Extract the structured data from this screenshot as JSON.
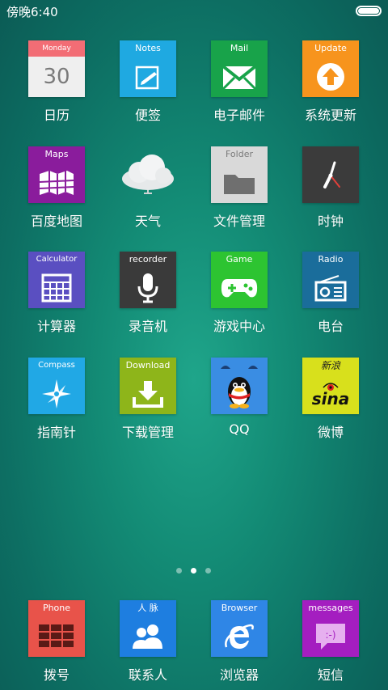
{
  "status": {
    "time": "傍晚6:40"
  },
  "apps": [
    {
      "label": "日历",
      "cap": "Monday",
      "date": "30"
    },
    {
      "label": "便签",
      "cap": "Notes"
    },
    {
      "label": "电子邮件",
      "cap": "Mail"
    },
    {
      "label": "系统更新",
      "cap": "Update"
    },
    {
      "label": "百度地图",
      "cap": "Maps"
    },
    {
      "label": "天气"
    },
    {
      "label": "文件管理",
      "cap": "Folder"
    },
    {
      "label": "时钟"
    },
    {
      "label": "计算器",
      "cap": "Calculator"
    },
    {
      "label": "录音机",
      "cap": "recorder"
    },
    {
      "label": "游戏中心",
      "cap": "Game"
    },
    {
      "label": "电台",
      "cap": "Radio"
    },
    {
      "label": "指南针",
      "cap": "Compass"
    },
    {
      "label": "下载管理",
      "cap": "Download"
    },
    {
      "label": "QQ"
    },
    {
      "label": "微博",
      "cap": "新浪",
      "logo": "sina"
    }
  ],
  "pager": {
    "pages": 3,
    "current": 2
  },
  "dock": [
    {
      "label": "拨号",
      "cap": "Phone"
    },
    {
      "label": "联系人",
      "cap": "人 脉"
    },
    {
      "label": "浏览器",
      "cap": "Browser"
    },
    {
      "label": "短信",
      "cap": "messages"
    }
  ],
  "colors": {
    "calendar_header": "#f26d75",
    "notes": "#1fa9e1",
    "mail": "#18a34a",
    "update": "#f7941d",
    "maps": "#8a1c9c",
    "folder": "#d9d9d9",
    "clock": "#3b3b3b",
    "calculator": "#5a4fc1",
    "recorder": "#3a3a3a",
    "game": "#2dc431",
    "radio": "#1a6d9b",
    "compass": "#21a8e5",
    "download": "#8eb51a",
    "qq": "#3a8de3",
    "weibo": "#d8e01c",
    "phone": "#e8534a",
    "contacts": "#1e7ee0",
    "browser": "#2f86e6",
    "messages": "#a41ec0"
  }
}
